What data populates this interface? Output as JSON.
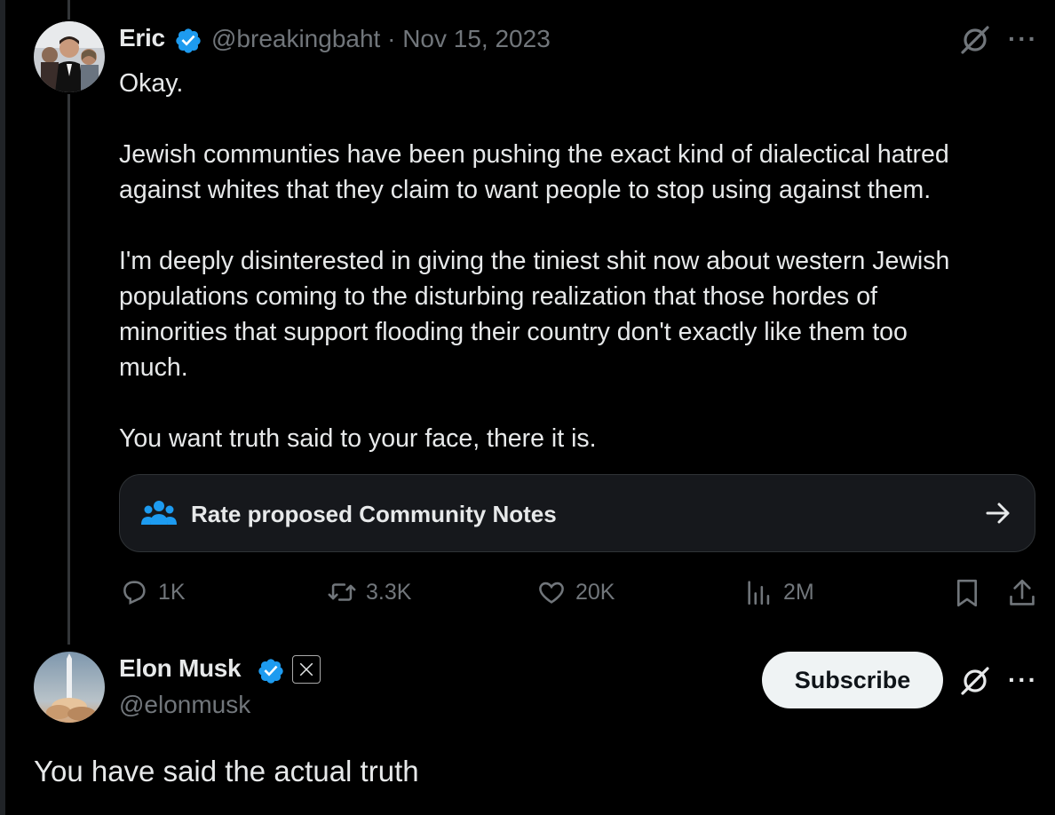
{
  "tweet": {
    "author_name": "Eric",
    "handle_date": "@breakingbaht · Nov 15, 2023",
    "paragraphs": [
      "Okay.",
      "Jewish communties have been pushing the exact kind of dialectical hatred\nagainst whites that they claim to want people to stop using against them.",
      "I'm deeply disinterested in giving the tiniest shit now about western Jewish\npopulations coming to the disturbing realization that those hordes of\nminorities that support flooding their country don't exactly like them too\nmuch.",
      "You want truth said to your face, there it is."
    ],
    "community_notes_label": "Rate proposed Community Notes",
    "more": "···",
    "stats": {
      "replies": "1K",
      "reposts": "3.3K",
      "likes": "20K",
      "views": "2M"
    }
  },
  "reply": {
    "author_name": "Elon Musk",
    "handle": "@elonmusk",
    "subscribe_label": "Subscribe",
    "more": "···",
    "text": "You have said the actual truth"
  },
  "colors": {
    "background": "#000000",
    "text": "#e7e9ea",
    "muted": "#71767b",
    "verified": "#1d9bf0",
    "card_bg": "#16181c"
  },
  "icons": [
    "verified-badge-icon",
    "grok-icon",
    "more-icon",
    "community-icon",
    "arrow-right-icon",
    "reply-icon",
    "repost-icon",
    "like-icon",
    "views-icon",
    "bookmark-icon",
    "share-icon",
    "x-logo-icon"
  ]
}
